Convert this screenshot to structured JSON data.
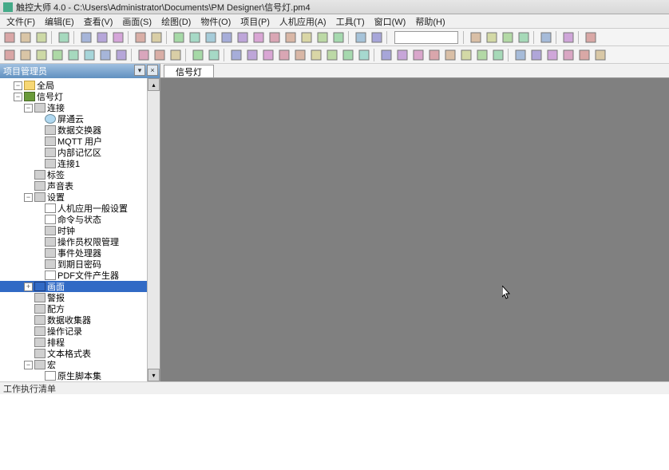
{
  "title": "触控大师 4.0 - C:\\Users\\Administrator\\Documents\\PM Designer\\信号灯.pm4",
  "menus": [
    "文件(F)",
    "编辑(E)",
    "查看(V)",
    "画面(S)",
    "绘图(D)",
    "物件(O)",
    "项目(P)",
    "人机应用(A)",
    "工具(T)",
    "窗口(W)",
    "帮助(H)"
  ],
  "panel": {
    "title": "项目管理员"
  },
  "tab": {
    "label": "信号灯"
  },
  "status": "工作执行清单",
  "tree": [
    {
      "level": 0,
      "toggle": "-",
      "icon": "folder",
      "label": "全局",
      "sel": false
    },
    {
      "level": 0,
      "toggle": "-",
      "icon": "book",
      "label": "信号灯",
      "sel": false
    },
    {
      "level": 1,
      "toggle": "-",
      "icon": "item",
      "label": "连接",
      "sel": false
    },
    {
      "level": 2,
      "toggle": "",
      "icon": "cloud",
      "label": "屏通云",
      "sel": false
    },
    {
      "level": 2,
      "toggle": "",
      "icon": "item",
      "label": "数据交换器",
      "sel": false
    },
    {
      "level": 2,
      "toggle": "",
      "icon": "item",
      "label": "MQTT 用户",
      "sel": false
    },
    {
      "level": 2,
      "toggle": "",
      "icon": "item",
      "label": "内部记忆区",
      "sel": false
    },
    {
      "level": 2,
      "toggle": "",
      "icon": "item",
      "label": "连接1",
      "sel": false
    },
    {
      "level": 1,
      "toggle": "",
      "icon": "item",
      "label": "标签",
      "sel": false
    },
    {
      "level": 1,
      "toggle": "",
      "icon": "item",
      "label": "声音表",
      "sel": false
    },
    {
      "level": 1,
      "toggle": "-",
      "icon": "item",
      "label": "设置",
      "sel": false
    },
    {
      "level": 2,
      "toggle": "",
      "icon": "doc",
      "label": "人机应用一般设置",
      "sel": false
    },
    {
      "level": 2,
      "toggle": "",
      "icon": "doc",
      "label": "命令与状态",
      "sel": false
    },
    {
      "level": 2,
      "toggle": "",
      "icon": "item",
      "label": "时钟",
      "sel": false
    },
    {
      "level": 2,
      "toggle": "",
      "icon": "item",
      "label": "操作员权限管理",
      "sel": false
    },
    {
      "level": 2,
      "toggle": "",
      "icon": "item",
      "label": "事件处理器",
      "sel": false
    },
    {
      "level": 2,
      "toggle": "",
      "icon": "item",
      "label": "到期日密码",
      "sel": false
    },
    {
      "level": 2,
      "toggle": "",
      "icon": "doc",
      "label": "PDF文件产生器",
      "sel": false
    },
    {
      "level": 1,
      "toggle": "+",
      "icon": "sel",
      "label": "画面",
      "sel": true
    },
    {
      "level": 1,
      "toggle": "",
      "icon": "item",
      "label": "警报",
      "sel": false
    },
    {
      "level": 1,
      "toggle": "",
      "icon": "item",
      "label": "配方",
      "sel": false
    },
    {
      "level": 1,
      "toggle": "",
      "icon": "item",
      "label": "数据收集器",
      "sel": false
    },
    {
      "level": 1,
      "toggle": "",
      "icon": "item",
      "label": "操作记录",
      "sel": false
    },
    {
      "level": 1,
      "toggle": "",
      "icon": "item",
      "label": "排程",
      "sel": false
    },
    {
      "level": 1,
      "toggle": "",
      "icon": "item",
      "label": "文本格式表",
      "sel": false
    },
    {
      "level": 1,
      "toggle": "-",
      "icon": "item",
      "label": "宏",
      "sel": false
    },
    {
      "level": 2,
      "toggle": "",
      "icon": "doc",
      "label": "原生脚本集",
      "sel": false
    }
  ],
  "toolbar1_icons": [
    "new",
    "open",
    "magnify",
    "divider",
    "save",
    "divider",
    "cut",
    "copy",
    "paste",
    "divider",
    "undo",
    "redo",
    "divider",
    "grid",
    "rect",
    "circle",
    "line",
    "poly",
    "text",
    "image",
    "group",
    "ungroup",
    "zoom-in",
    "zoom-out",
    "divider",
    "align",
    "distribute",
    "divider",
    "combo",
    "divider",
    "run",
    "stop",
    "config",
    "download",
    "divider",
    "tools",
    "divider",
    "link",
    "divider",
    "help"
  ],
  "toolbar2_icons": [
    "obj1",
    "obj2",
    "obj3",
    "obj4",
    "obj5",
    "obj6",
    "obj7",
    "obj8",
    "sep",
    "a1",
    "a2",
    "a3",
    "sep",
    "shape1",
    "shape2",
    "sep",
    "btn",
    "lamp",
    "disp",
    "input",
    "meter",
    "bar",
    "trend",
    "alarm",
    "table",
    "sep",
    "s1",
    "s2",
    "s3",
    "s4",
    "s5",
    "s6",
    "s7",
    "s8",
    "sep",
    "t1",
    "t2",
    "t3",
    "t4",
    "t5",
    "t6"
  ],
  "colors": {
    "accent": "#316ac5",
    "panel_header": "#6090c0",
    "canvas": "#808080"
  }
}
